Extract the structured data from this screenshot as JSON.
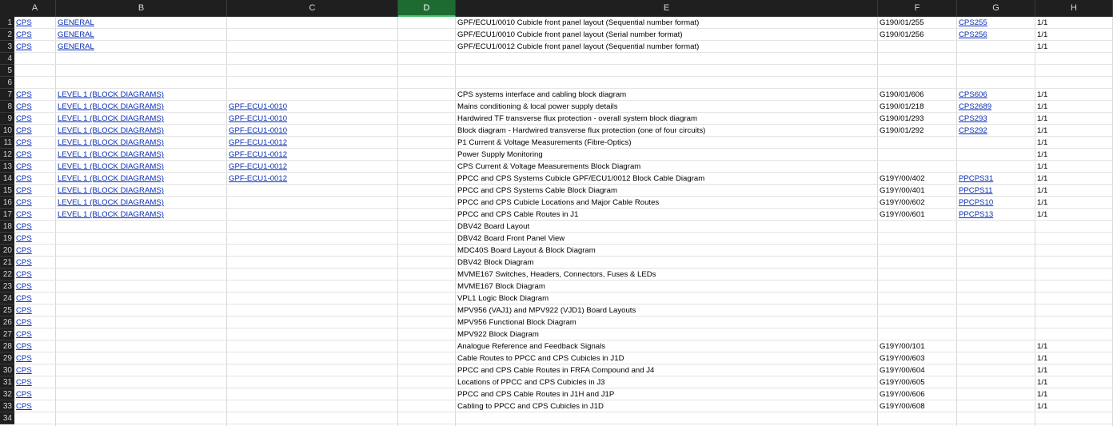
{
  "columns": [
    "A",
    "B",
    "C",
    "D",
    "E",
    "F",
    "G",
    "H"
  ],
  "selected_column": "D",
  "rows": [
    {
      "n": "1",
      "a": "CPS",
      "b": "GENERAL",
      "c": "",
      "e": "GPF/ECU1/0010 Cubicle front panel layout (Sequential number format)",
      "f": "G190/01/255",
      "g": "CPS255",
      "h": "1/1"
    },
    {
      "n": "2",
      "a": "CPS",
      "b": "GENERAL",
      "c": "",
      "e": "GPF/ECU1/0010 Cubicle front panel layout (Serial number format)",
      "f": "G190/01/256",
      "g": "CPS256",
      "h": "1/1"
    },
    {
      "n": "3",
      "a": "CPS",
      "b": "GENERAL",
      "c": "",
      "e": "GPF/ECU1/0012 Cubicle front panel layout (Sequential number format)",
      "f": "",
      "g": "",
      "h": "1/1"
    },
    {
      "n": "4",
      "a": "",
      "b": "",
      "c": "",
      "e": "",
      "f": "",
      "g": "",
      "h": ""
    },
    {
      "n": "5",
      "a": "",
      "b": "",
      "c": "",
      "e": "",
      "f": "",
      "g": "",
      "h": ""
    },
    {
      "n": "6",
      "a": "",
      "b": "",
      "c": "",
      "e": "",
      "f": "",
      "g": "",
      "h": ""
    },
    {
      "n": "7",
      "a": "CPS",
      "b": "LEVEL 1 (BLOCK DIAGRAMS)",
      "c": "",
      "e": "CPS systems interface and cabling block diagram",
      "f": "G190/01/606",
      "g": "CPS606",
      "h": "1/1"
    },
    {
      "n": "8",
      "a": "CPS",
      "b": "LEVEL 1 (BLOCK DIAGRAMS)",
      "c": "GPF-ECU1-0010",
      "e": "Mains conditioning & local power supply details",
      "f": "G190/01/218",
      "g": "CPS2689",
      "h": "1/1"
    },
    {
      "n": "9",
      "a": "CPS",
      "b": "LEVEL 1 (BLOCK DIAGRAMS)",
      "c": "GPF-ECU1-0010",
      "e": "Hardwired TF transverse flux protection - overall system block diagram",
      "f": "G190/01/293",
      "g": "CPS293",
      "h": "1/1"
    },
    {
      "n": "10",
      "a": "CPS",
      "b": "LEVEL 1 (BLOCK DIAGRAMS)",
      "c": "GPF-ECU1-0010",
      "e": "Block diagram - Hardwired transverse flux protection (one of four circuits)",
      "f": "G190/01/292",
      "g": "CPS292",
      "h": "1/1"
    },
    {
      "n": "11",
      "a": "CPS",
      "b": "LEVEL 1 (BLOCK DIAGRAMS)",
      "c": "GPF-ECU1-0012",
      "e": "P1 Current & Voltage Measurements (Fibre-Optics)",
      "f": "",
      "g": "",
      "h": "1/1"
    },
    {
      "n": "12",
      "a": "CPS",
      "b": "LEVEL 1 (BLOCK DIAGRAMS)",
      "c": "GPF-ECU1-0012",
      "e": "Power Supply Monitoring",
      "f": "",
      "g": "",
      "h": "1/1"
    },
    {
      "n": "13",
      "a": "CPS",
      "b": "LEVEL 1 (BLOCK DIAGRAMS)",
      "c": "GPF-ECU1-0012",
      "e": "CPS Current & Voltage Measurements Block Diagram",
      "f": "",
      "g": "",
      "h": "1/1"
    },
    {
      "n": "14",
      "a": "CPS",
      "b": "LEVEL 1 (BLOCK DIAGRAMS)",
      "c": "GPF-ECU1-0012",
      "e": "PPCC and CPS Systems Cubicle GPF/ECU1/0012 Block Cable Diagram",
      "f": "G19Y/00/402",
      "g": "PPCPS31",
      "h": "1/1"
    },
    {
      "n": "15",
      "a": "CPS",
      "b": "LEVEL 1 (BLOCK DIAGRAMS)",
      "c": "",
      "e": "PPCC and CPS Systems Cable Block Diagram",
      "f": "G19Y/00/401",
      "g": "PPCPS11",
      "h": "1/1"
    },
    {
      "n": "16",
      "a": "CPS",
      "b": "LEVEL 1 (BLOCK DIAGRAMS)",
      "c": "",
      "e": "PPCC and CPS Cubicle Locations and Major Cable Routes",
      "f": "G19Y/00/602",
      "g": "PPCPS10",
      "h": "1/1"
    },
    {
      "n": "17",
      "a": "CPS",
      "b": "LEVEL 1 (BLOCK DIAGRAMS)",
      "c": "",
      "e": "PPCC and CPS Cable Routes in J1",
      "f": "G19Y/00/601",
      "g": "PPCPS13",
      "h": "1/1"
    },
    {
      "n": "18",
      "a": "CPS",
      "b": "",
      "c": "",
      "e": "DBV42 Board Layout",
      "f": "",
      "g": "",
      "h": ""
    },
    {
      "n": "19",
      "a": "CPS",
      "b": "",
      "c": "",
      "e": "DBV42 Board Front Panel View",
      "f": "",
      "g": "",
      "h": ""
    },
    {
      "n": "20",
      "a": "CPS",
      "b": "",
      "c": "",
      "e": "MDC40S Board Layout & Block Diagram",
      "f": "",
      "g": "",
      "h": ""
    },
    {
      "n": "21",
      "a": "CPS",
      "b": "",
      "c": "",
      "e": "DBV42 Block Diagram",
      "f": "",
      "g": "",
      "h": ""
    },
    {
      "n": "22",
      "a": "CPS",
      "b": "",
      "c": "",
      "e": "MVME167 Switches, Headers, Connectors, Fuses & LEDs",
      "f": "",
      "g": "",
      "h": ""
    },
    {
      "n": "23",
      "a": "CPS",
      "b": "",
      "c": "",
      "e": "MVME167 Block Diagram",
      "f": "",
      "g": "",
      "h": ""
    },
    {
      "n": "24",
      "a": "CPS",
      "b": "",
      "c": "",
      "e": "VPL1 Logic Block Diagram",
      "f": "",
      "g": "",
      "h": ""
    },
    {
      "n": "25",
      "a": "CPS",
      "b": "",
      "c": "",
      "e": "MPV956 (VAJ1) and MPV922 (VJD1) Board Layouts",
      "f": "",
      "g": "",
      "h": ""
    },
    {
      "n": "26",
      "a": "CPS",
      "b": "",
      "c": "",
      "e": "MPV956 Functional Block Diagram",
      "f": "",
      "g": "",
      "h": ""
    },
    {
      "n": "27",
      "a": "CPS",
      "b": "",
      "c": "",
      "e": "MPV922 Block Diagram",
      "f": "",
      "g": "",
      "h": ""
    },
    {
      "n": "28",
      "a": "CPS",
      "b": "",
      "c": "",
      "e": "Analogue Reference and Feedback Signals",
      "f": "G19Y/00/101",
      "g": "",
      "h": "1/1"
    },
    {
      "n": "29",
      "a": "CPS",
      "b": "",
      "c": "",
      "e": "Cable Routes to PPCC and CPS Cubicles in J1D",
      "f": "G19Y/00/603",
      "g": "",
      "h": "1/1"
    },
    {
      "n": "30",
      "a": "CPS",
      "b": "",
      "c": "",
      "e": "PPCC and CPS Cable Routes in FRFA Compound and J4",
      "f": "G19Y/00/604",
      "g": "",
      "h": "1/1"
    },
    {
      "n": "31",
      "a": "CPS",
      "b": "",
      "c": "",
      "e": "Locations of PPCC and CPS Cubicles in J3",
      "f": "G19Y/00/605",
      "g": "",
      "h": "1/1"
    },
    {
      "n": "32",
      "a": "CPS",
      "b": "",
      "c": "",
      "e": "PPCC and CPS Cable Routes in J1H and J1P",
      "f": "G19Y/00/606",
      "g": "",
      "h": "1/1"
    },
    {
      "n": "33",
      "a": "CPS",
      "b": "",
      "c": "",
      "e": "Cabling to PPCC and CPS Cubicles in J1D",
      "f": "G19Y/00/608",
      "g": "",
      "h": "1/1"
    },
    {
      "n": "34",
      "a": "",
      "b": "",
      "c": "",
      "e": "",
      "f": "",
      "g": "",
      "h": ""
    }
  ]
}
